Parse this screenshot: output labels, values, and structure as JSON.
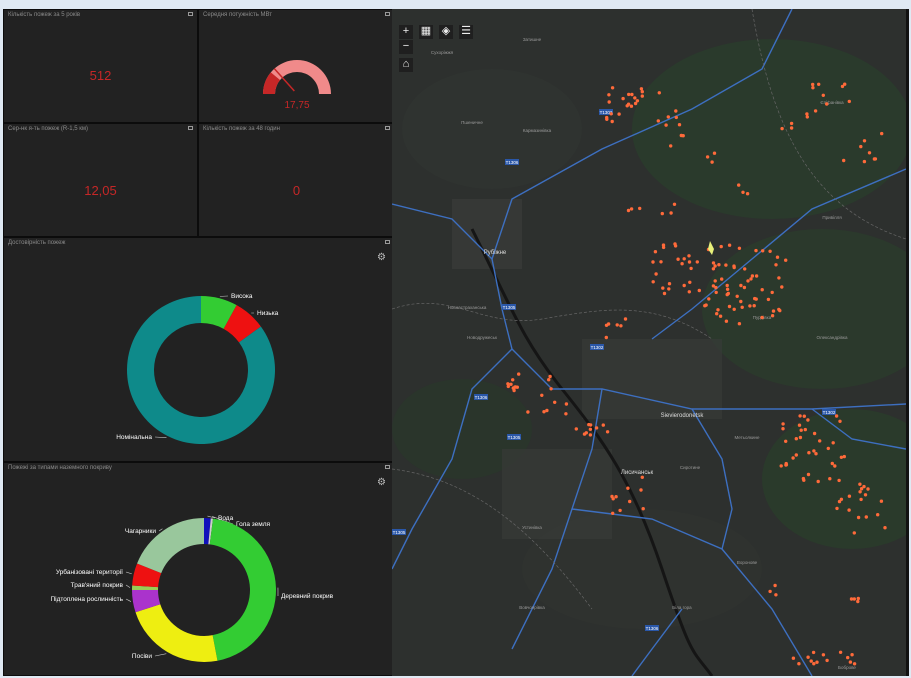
{
  "panels": {
    "fires_5y": {
      "title": "Кількість пожеж за 5 років",
      "value": "512"
    },
    "avg_power": {
      "title": "Середня потужність МВт",
      "value": "17,75",
      "gauge_fraction": 0.22
    },
    "brightness": {
      "title": "Сер-нк я-ть пожеж (R-1,5 км)",
      "value": "12,05"
    },
    "fires_48h": {
      "title": "Кількість пожеж за 48 годин",
      "value": "0"
    }
  },
  "confidence": {
    "title": "Достовірність пожеж"
  },
  "landcover": {
    "title": "Пожежі за типами наземного покриву"
  },
  "chart_data": [
    {
      "type": "pie",
      "title": "Достовірність пожеж",
      "categories": [
        "Висока",
        "Низька",
        "Номінальна"
      ],
      "values": [
        8,
        7,
        85
      ],
      "colors": [
        "#33cc33",
        "#ee1111",
        "#0e8a8a"
      ]
    },
    {
      "type": "pie",
      "title": "Пожежі за типами наземного покриву",
      "categories": [
        "Вода",
        "Гола земля",
        "Деревний покрив",
        "Посіви",
        "Підтоплена рослинність",
        "Трав'яний покрив",
        "Урбанізовані території",
        "Чагарники"
      ],
      "values": [
        1.5,
        0.5,
        45,
        23,
        5,
        1,
        5,
        19
      ],
      "colors": [
        "#1111bb",
        "#cccccc",
        "#33cc33",
        "#eeee11",
        "#aa33cc",
        "#99cc55",
        "#ee1111",
        "#99c79c"
      ]
    }
  ],
  "map": {
    "places": [
      "Сухоріжжя",
      "Затишне",
      "Пшеничне",
      "Кармазинівка",
      "Рубіжне",
      "Новодружеськ",
      "Sievierodonetsk",
      "Лисичанськ",
      "Метьолкине",
      "Сиротине",
      "Біла гора",
      "Воронове",
      "Пурдівка",
      "Олександрівка",
      "Привілля",
      "Устинівка",
      "Вовчоярівка",
      "Боброве",
      "Єпіфанівка",
      "Новоастраханська"
    ],
    "roads": [
      "T1302",
      "T1306",
      "T1305"
    ],
    "buttons": {
      "zoom_in": "+",
      "zoom_out": "−",
      "home": "⌂",
      "basemap": "▦",
      "layers": "◈",
      "legend": "☰"
    }
  },
  "colors": {
    "value_red": "#c62727",
    "fire_dot": "#ff6a3a",
    "panel_bg": "#222222",
    "map_bg": "#2d302e",
    "roads": "#3d6fc0"
  }
}
